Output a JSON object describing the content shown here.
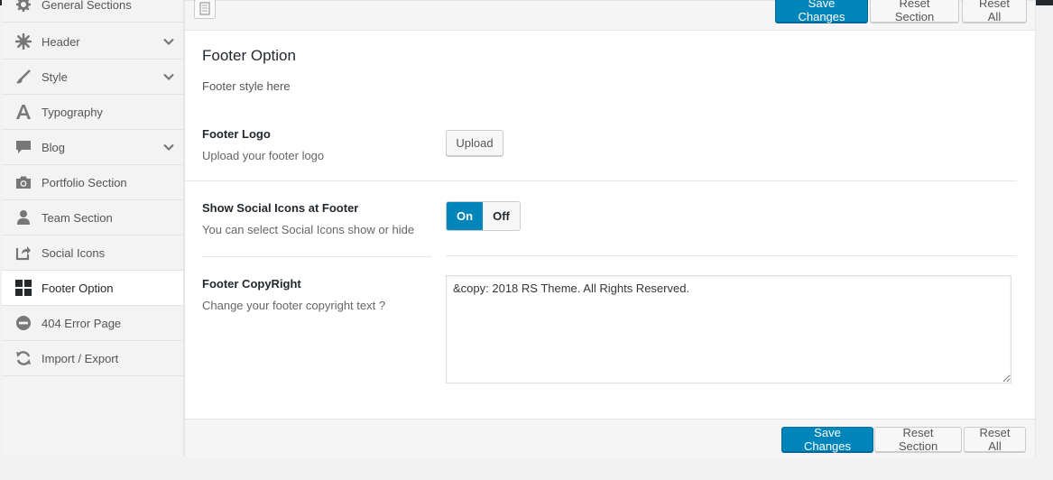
{
  "sidebar": {
    "items": [
      {
        "label": "General Sections",
        "icon": "gear-icon",
        "expandable": false
      },
      {
        "label": "Header",
        "icon": "burst-icon",
        "expandable": true
      },
      {
        "label": "Style",
        "icon": "brush-icon",
        "expandable": true
      },
      {
        "label": "Typography",
        "icon": "typography-icon",
        "expandable": false
      },
      {
        "label": "Blog",
        "icon": "comment-icon",
        "expandable": true
      },
      {
        "label": "Portfolio Section",
        "icon": "camera-icon",
        "expandable": false
      },
      {
        "label": "Team Section",
        "icon": "user-icon",
        "expandable": false
      },
      {
        "label": "Social Icons",
        "icon": "share-icon",
        "expandable": false
      },
      {
        "label": "Footer Option",
        "icon": "grid-icon",
        "expandable": false,
        "active": true
      },
      {
        "label": "404 Error Page",
        "icon": "minus-circle-icon",
        "expandable": false
      },
      {
        "label": "Import / Export",
        "icon": "refresh-icon",
        "expandable": false
      }
    ]
  },
  "toolbar": {
    "save_label": "Save Changes",
    "reset_section_label": "Reset Section",
    "reset_all_label": "Reset All"
  },
  "section": {
    "title": "Footer Option",
    "description": "Footer style here"
  },
  "fields": {
    "logo": {
      "label": "Footer Logo",
      "description": "Upload your footer logo",
      "button": "Upload"
    },
    "social": {
      "label": "Show Social Icons at Footer",
      "description": "You can select Social Icons show or hide",
      "on_label": "On",
      "off_label": "Off",
      "value": "On"
    },
    "copyright": {
      "label": "Footer CopyRight",
      "description": "Change your footer copyright text ?",
      "value": "&copy: 2018 RS Theme. All Rights Reserved."
    }
  },
  "colors": {
    "primary": "#0085ba",
    "topbar": "#23282d"
  }
}
